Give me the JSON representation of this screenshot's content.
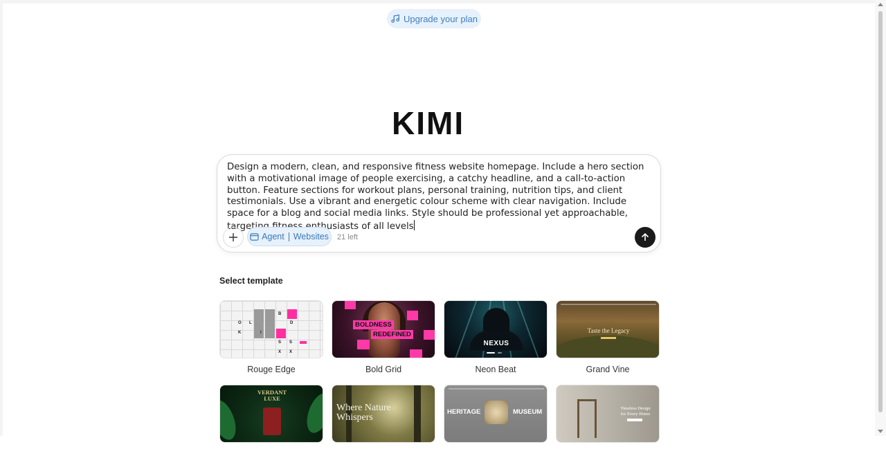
{
  "header": {
    "upgrade_label": "Upgrade your plan",
    "upgrade_icon": "music-notes-icon"
  },
  "brand": {
    "logo_text": "KIMI"
  },
  "composer": {
    "prompt_text": "Design a modern, clean, and responsive fitness website homepage. Include a hero section with a motivational image of people exercising, a catchy headline, and a call-to-action button. Feature sections for workout plans, personal training, nutrition tips, and client testimonials. Use a vibrant and energetic colour scheme with clear navigation. Include space for a blog and social media links. Style should be professional yet approachable, targeting fitness enthusiasts of all levels",
    "mode_agent": "Agent",
    "mode_websites": "Websites",
    "remaining": "21 left",
    "accent_color": "#3a78b8"
  },
  "templates": {
    "section_title": "Select template",
    "items": [
      {
        "label": "Rouge Edge"
      },
      {
        "label": "Bold Grid",
        "thumb_text_1": "BOLDNESS",
        "thumb_text_2": "REDEFINED"
      },
      {
        "label": "Neon Beat",
        "thumb_text": "NEXUS"
      },
      {
        "label": "Grand Vine",
        "thumb_text": "Taste the Legacy"
      },
      {
        "label": "",
        "thumb_text_1": "VERDANT",
        "thumb_text_2": "LUXE"
      },
      {
        "label": "",
        "thumb_text_1": "Where Nature",
        "thumb_text_2": "Whispers"
      },
      {
        "label": "",
        "thumb_text_1": "HERITAGE",
        "thumb_text_2": "MUSEUM"
      },
      {
        "label": "",
        "thumb_text_1": "Timeless Design",
        "thumb_text_2": "for Every Home"
      }
    ]
  },
  "rouge_letters": [
    "O",
    "L",
    "D",
    "K",
    "I",
    "S",
    "S",
    "X",
    "X",
    "B"
  ]
}
